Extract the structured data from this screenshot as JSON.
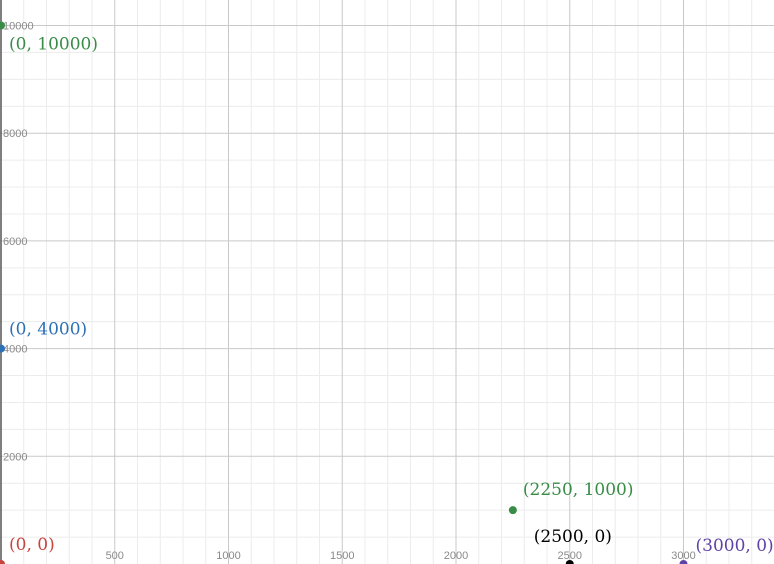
{
  "chart_data": {
    "type": "scatter",
    "xlim": [
      0,
      3390
    ],
    "ylim": [
      0,
      10430
    ],
    "grid": true,
    "x_ticks": [
      "500",
      "1000",
      "1500",
      "2000",
      "2500",
      "3000"
    ],
    "y_ticks": [
      "2000",
      "4000",
      "6000",
      "8000",
      "10000"
    ],
    "points": [
      {
        "x": 0,
        "y": 10000,
        "label": "(0, 10000)",
        "color": "#388c46"
      },
      {
        "x": 0,
        "y": 4000,
        "label": "(0, 4000)",
        "color": "#2d70b3"
      },
      {
        "x": 0,
        "y": 0,
        "label": "(0, 0)",
        "color": "#c74440"
      },
      {
        "x": 2250,
        "y": 1000,
        "label": "(2250, 1000)",
        "color": "#388c46"
      },
      {
        "x": 2500,
        "y": 0,
        "label": "(2500, 0)",
        "color": "#000000"
      },
      {
        "x": 3000,
        "y": 0,
        "label": "(3000, 0)",
        "color": "#6042a6"
      }
    ]
  }
}
